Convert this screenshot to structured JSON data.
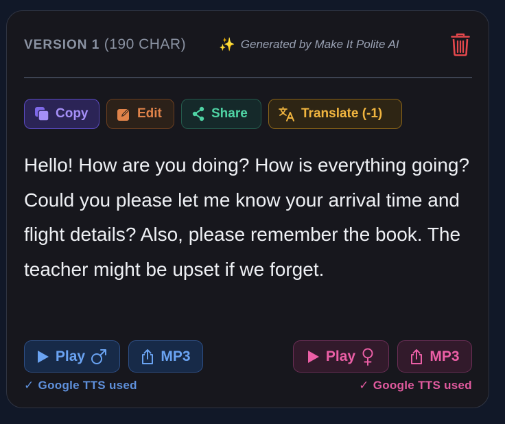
{
  "header": {
    "version_label": "VERSION 1",
    "char_count": "(190 CHAR)",
    "sparkle_icon": "✨",
    "generated_text": "Generated by Make It Polite AI",
    "delete_icon": "trash-icon"
  },
  "actions": {
    "copy_label": "Copy",
    "edit_label": "Edit",
    "share_label": "Share",
    "translate_label": "Translate (-1)"
  },
  "message": "Hello! How are you doing? How is everything going? Could you please let me know your arrival time and flight details? Also, please remember the book. The teacher might be upset if we forget.",
  "audio": {
    "male": {
      "play_label": "Play",
      "gender_icon": "♂",
      "mp3_label": "MP3",
      "tts_note": "Google TTS used"
    },
    "female": {
      "play_label": "Play",
      "gender_icon": "♀",
      "mp3_label": "MP3",
      "tts_note": "Google TTS used"
    },
    "check_icon": "✓"
  },
  "colors": {
    "background": "#111828",
    "card": "#17171d",
    "copy": "#a58ff7",
    "edit": "#e0834a",
    "share": "#4fd3a4",
    "translate": "#f1b53f",
    "male": "#6aa3f2",
    "female": "#ec5fa6",
    "delete": "#e5484d"
  }
}
